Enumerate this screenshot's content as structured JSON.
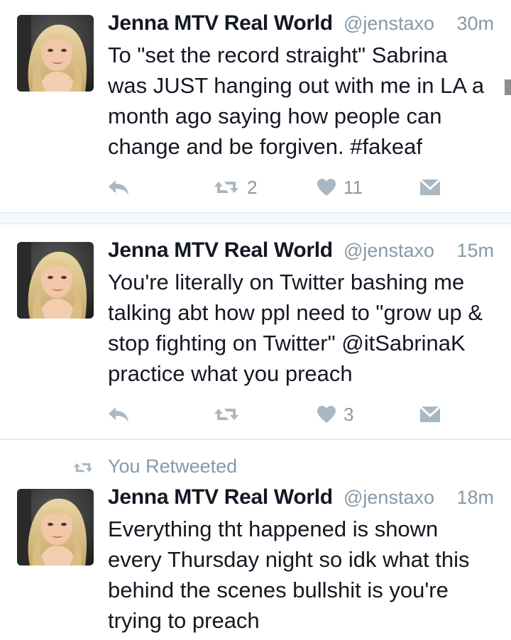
{
  "colors": {
    "text_primary": "#141823",
    "text_secondary": "#8899a6",
    "icon_gray": "#aab8c2",
    "divider": "#e1e8ed"
  },
  "tweets": [
    {
      "display_name": "Jenna MTV Real World",
      "handle": "@jenstaxo",
      "time": "30m",
      "text": "To \"set the record straight\" Sabrina\nwas JUST hanging out with me in LA a\nmonth ago saying how people can\nchange and be forgiven.   #fakeaf",
      "retweet_count": "2",
      "like_count": "11",
      "icons": [
        "reply-icon",
        "retweet-icon",
        "heart-icon",
        "direct-message-icon"
      ]
    },
    {
      "display_name": "Jenna MTV Real World",
      "handle": "@jenstaxo",
      "time": "15m",
      "text": "You're literally on Twitter bashing me\ntalking abt how ppl need to \"grow up &\nstop fighting on Twitter\" @itSabrinaK\npractice what you preach",
      "retweet_count": "",
      "like_count": "3",
      "icons": [
        "reply-icon",
        "retweet-icon",
        "heart-icon",
        "direct-message-icon"
      ]
    },
    {
      "retweet_context": "You Retweeted",
      "display_name": "Jenna MTV Real World",
      "handle": "@jenstaxo",
      "time": "18m",
      "text": "Everything tht happened is shown\nevery Thursday night so idk what this\nbehind the scenes bullshit is you're\ntrying to preach",
      "icons": [
        "retweet-icon"
      ]
    }
  ]
}
